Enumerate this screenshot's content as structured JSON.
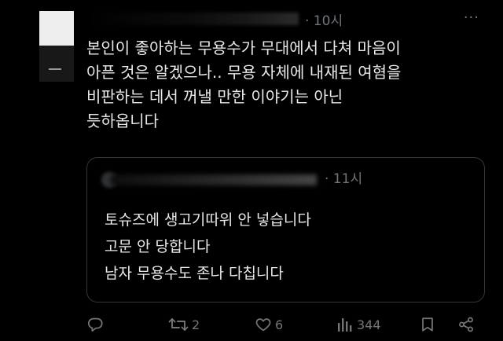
{
  "tweet": {
    "time": "· 10시",
    "more_icon": "more-dots-icon",
    "lines": [
      "본인이 좋아하는 무용수가 무대에서 다쳐 마음이",
      "아픈 것은 알겠으나.. 무용 자체에 내재된 여혐을",
      "비판하는 데서 꺼낼 만한 이야기는 아닌",
      "듯하옵니다"
    ]
  },
  "quote": {
    "time": "· 11시",
    "lines": [
      "토슈즈에 생고기따위 안 넣습니다",
      "고문 안 당합니다",
      "남자 무용수도 존나 다칩니다"
    ]
  },
  "actions": {
    "reply": {
      "icon": "reply-icon",
      "count": ""
    },
    "retweet": {
      "icon": "retweet-icon",
      "count": "2"
    },
    "like": {
      "icon": "heart-icon",
      "count": "6"
    },
    "views": {
      "icon": "views-chart-icon",
      "count": "344"
    },
    "bookmark": {
      "icon": "bookmark-icon",
      "count": ""
    },
    "share": {
      "icon": "share-icon",
      "count": ""
    }
  },
  "colors": {
    "background": "#000000",
    "text": "#e7e9ea",
    "secondary": "#71767b",
    "border": "#333639"
  }
}
